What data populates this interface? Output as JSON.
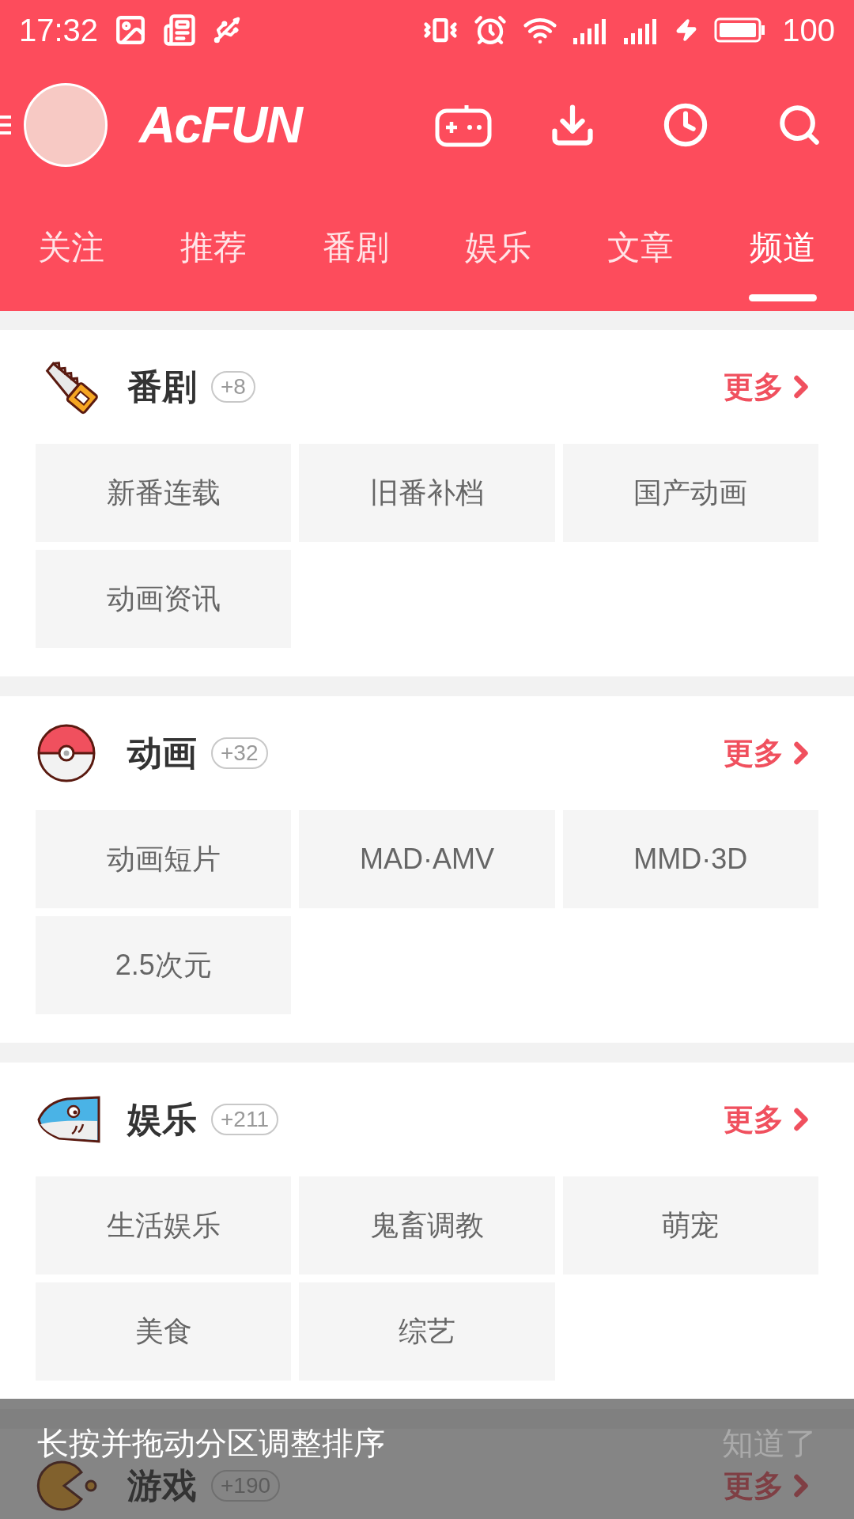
{
  "status_bar": {
    "time": "17:32",
    "battery": "100"
  },
  "header": {
    "logo": "AcFUN"
  },
  "tabs": [
    {
      "label": "关注",
      "selected": false
    },
    {
      "label": "推荐",
      "selected": false
    },
    {
      "label": "番剧",
      "selected": false
    },
    {
      "label": "娱乐",
      "selected": false
    },
    {
      "label": "文章",
      "selected": false
    },
    {
      "label": "频道",
      "selected": true
    }
  ],
  "sections": [
    {
      "kind": "saw",
      "title": "番剧",
      "count": "+8",
      "more": "更多",
      "items": [
        "新番连载",
        "旧番补档",
        "国产动画",
        "动画资讯"
      ]
    },
    {
      "kind": "ball",
      "title": "动画",
      "count": "+32",
      "more": "更多",
      "items": [
        "动画短片",
        "MAD·AMV",
        "MMD·3D",
        "2.5次元"
      ]
    },
    {
      "kind": "fish",
      "title": "娱乐",
      "count": "+211",
      "more": "更多",
      "items": [
        "生活娱乐",
        "鬼畜调教",
        "萌宠",
        "美食",
        "综艺"
      ]
    },
    {
      "kind": "pacman",
      "title": "游戏",
      "count": "+190",
      "more": "更多"
    }
  ],
  "snackbar": {
    "message": "长按并拖动分区调整排序",
    "action": "知道了"
  }
}
